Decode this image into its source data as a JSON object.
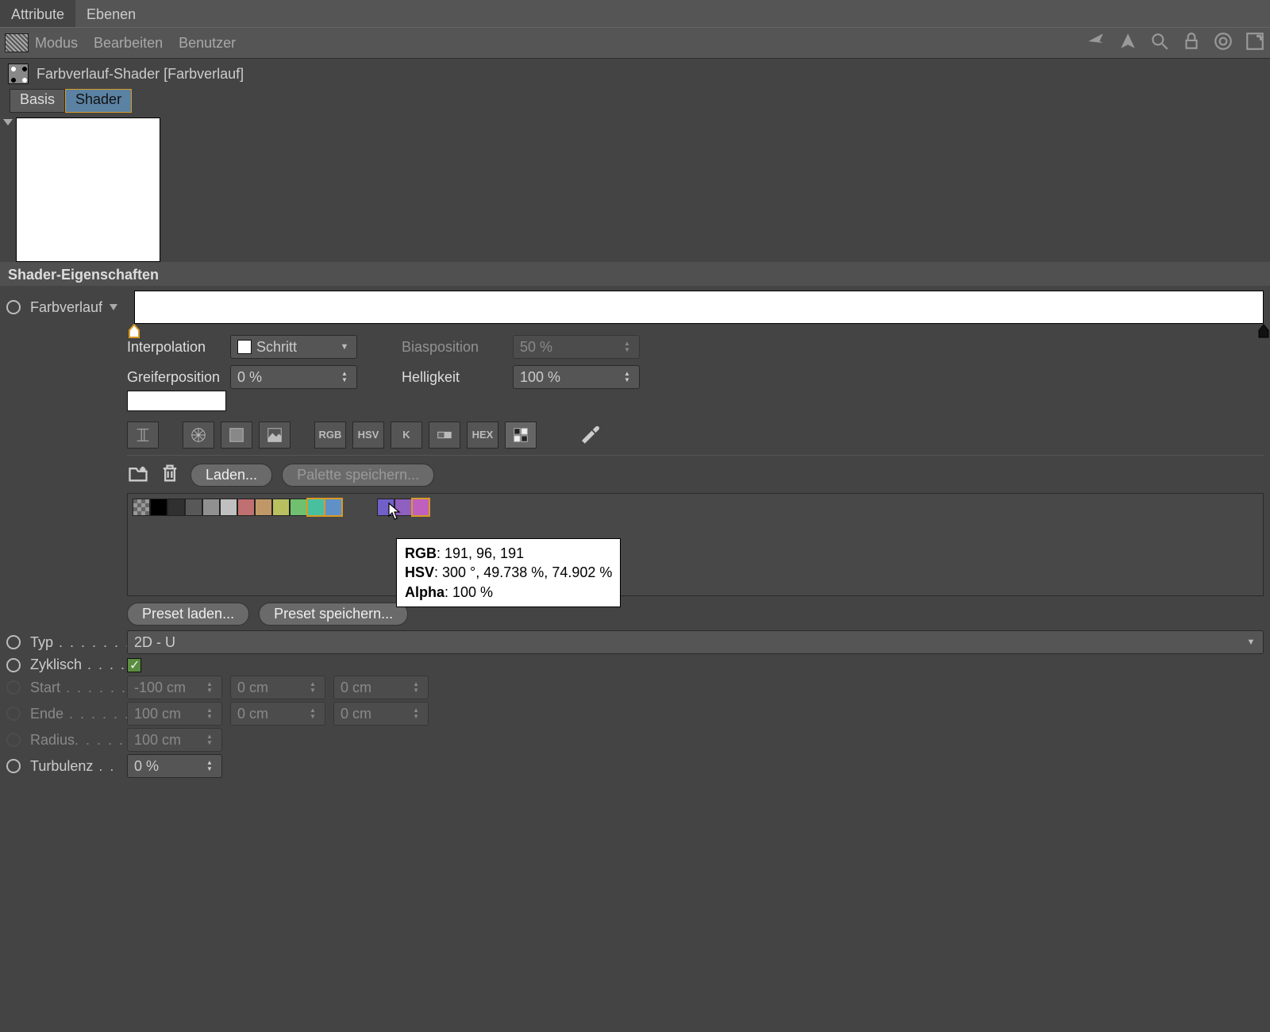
{
  "panel_tabs": {
    "attribute": "Attribute",
    "layers": "Ebenen"
  },
  "menubar": {
    "mode": "Modus",
    "edit": "Bearbeiten",
    "user": "Benutzer"
  },
  "object": {
    "title": "Farbverlauf-Shader [Farbverlauf]"
  },
  "obj_tabs": {
    "basis": "Basis",
    "shader": "Shader"
  },
  "section": {
    "title": "Shader-Eigenschaften"
  },
  "labels": {
    "gradient": "Farbverlauf",
    "interpolation": "Interpolation",
    "knot_pos": "Greiferposition",
    "bias_pos": "Biasposition",
    "brightness": "Helligkeit",
    "type": "Typ",
    "cyclic": "Zyklisch",
    "start": "Start",
    "end": "Ende",
    "radius": "Radius",
    "turbulence": "Turbulenz"
  },
  "values": {
    "interpolation": "Schritt",
    "knot_pos": "0 %",
    "bias_pos": "50 %",
    "brightness": "100 %",
    "type": "2D - U",
    "start": [
      "-100 cm",
      "0 cm",
      "0 cm"
    ],
    "end": [
      "100 cm",
      "0 cm",
      "0 cm"
    ],
    "radius": "100 cm",
    "turbulence": "0 %"
  },
  "tool_labels": {
    "rgb": "RGB",
    "hsv": "HSV",
    "k": "K",
    "hex": "HEX"
  },
  "palette_buttons": {
    "load": "Laden...",
    "save": "Palette speichern..."
  },
  "preset_buttons": {
    "load": "Preset laden...",
    "save": "Preset speichern..."
  },
  "swatches": [
    "#000000",
    "#303030",
    "#585858",
    "#909090",
    "#c0c0c0",
    "#c07070",
    "#c09868",
    "#b8c060",
    "#70c070",
    "#48c0a0",
    "#6090c8",
    "gap",
    "gap",
    "#7060c8",
    "#9060c0",
    "#bf60bf"
  ],
  "selected_swatches": [
    9,
    10,
    15
  ],
  "tooltip": {
    "rgb_label": "RGB",
    "rgb_val": ": 191, 96, 191",
    "hsv_label": "HSV",
    "hsv_val": ": 300 °, 49.738 %, 74.902 %",
    "alpha_label": "Alpha",
    "alpha_val": ": 100 %"
  }
}
